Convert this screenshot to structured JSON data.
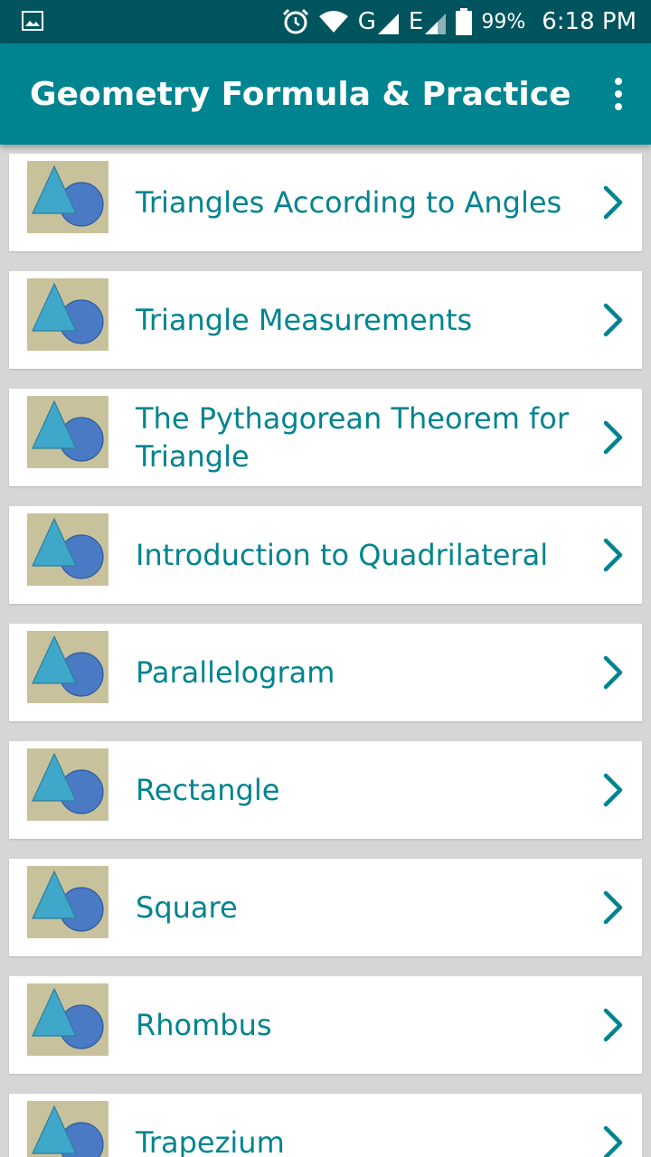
{
  "status_bar": {
    "signal_network_1": "G",
    "signal_network_2": "E",
    "battery_percent": "99%",
    "time": "6:18 PM"
  },
  "app_bar": {
    "title": "Geometry Formula & Practice"
  },
  "list": {
    "items": [
      {
        "label": "Triangles According to Angles"
      },
      {
        "label": "Triangle Measurements"
      },
      {
        "label": "The Pythagorean Theorem for Triangle"
      },
      {
        "label": "Introduction to Quadrilateral"
      },
      {
        "label": "Parallelogram"
      },
      {
        "label": "Rectangle"
      },
      {
        "label": "Square"
      },
      {
        "label": "Rhombus"
      },
      {
        "label": "Trapezium"
      }
    ]
  },
  "colors": {
    "status_bar": "#00545e",
    "app_bar": "#00848f",
    "accent_text": "#00848f",
    "thumb_bg": "#c8c29c",
    "thumb_triangle": "#3fa7c9",
    "thumb_circle": "#4a7ac4"
  }
}
